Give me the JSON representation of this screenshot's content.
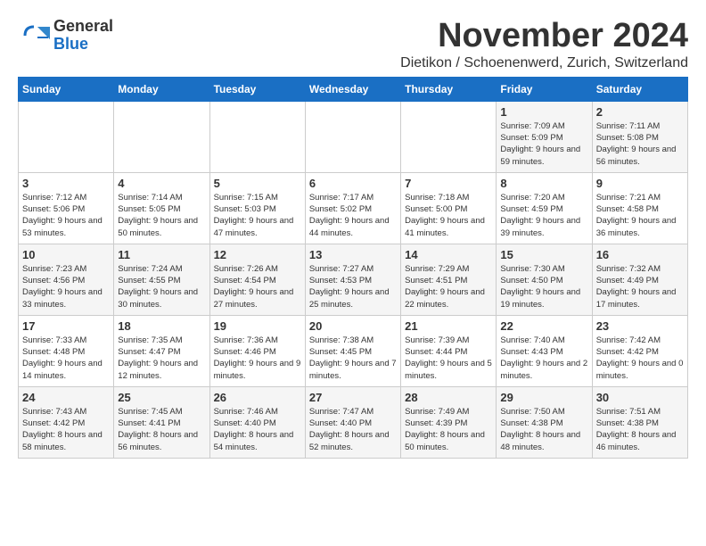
{
  "logo": {
    "general": "General",
    "blue": "Blue"
  },
  "title": "November 2024",
  "location": "Dietikon / Schoenenwerd, Zurich, Switzerland",
  "days_of_week": [
    "Sunday",
    "Monday",
    "Tuesday",
    "Wednesday",
    "Thursday",
    "Friday",
    "Saturday"
  ],
  "weeks": [
    [
      {
        "day": "",
        "info": ""
      },
      {
        "day": "",
        "info": ""
      },
      {
        "day": "",
        "info": ""
      },
      {
        "day": "",
        "info": ""
      },
      {
        "day": "",
        "info": ""
      },
      {
        "day": "1",
        "info": "Sunrise: 7:09 AM\nSunset: 5:09 PM\nDaylight: 9 hours and 59 minutes."
      },
      {
        "day": "2",
        "info": "Sunrise: 7:11 AM\nSunset: 5:08 PM\nDaylight: 9 hours and 56 minutes."
      }
    ],
    [
      {
        "day": "3",
        "info": "Sunrise: 7:12 AM\nSunset: 5:06 PM\nDaylight: 9 hours and 53 minutes."
      },
      {
        "day": "4",
        "info": "Sunrise: 7:14 AM\nSunset: 5:05 PM\nDaylight: 9 hours and 50 minutes."
      },
      {
        "day": "5",
        "info": "Sunrise: 7:15 AM\nSunset: 5:03 PM\nDaylight: 9 hours and 47 minutes."
      },
      {
        "day": "6",
        "info": "Sunrise: 7:17 AM\nSunset: 5:02 PM\nDaylight: 9 hours and 44 minutes."
      },
      {
        "day": "7",
        "info": "Sunrise: 7:18 AM\nSunset: 5:00 PM\nDaylight: 9 hours and 41 minutes."
      },
      {
        "day": "8",
        "info": "Sunrise: 7:20 AM\nSunset: 4:59 PM\nDaylight: 9 hours and 39 minutes."
      },
      {
        "day": "9",
        "info": "Sunrise: 7:21 AM\nSunset: 4:58 PM\nDaylight: 9 hours and 36 minutes."
      }
    ],
    [
      {
        "day": "10",
        "info": "Sunrise: 7:23 AM\nSunset: 4:56 PM\nDaylight: 9 hours and 33 minutes."
      },
      {
        "day": "11",
        "info": "Sunrise: 7:24 AM\nSunset: 4:55 PM\nDaylight: 9 hours and 30 minutes."
      },
      {
        "day": "12",
        "info": "Sunrise: 7:26 AM\nSunset: 4:54 PM\nDaylight: 9 hours and 27 minutes."
      },
      {
        "day": "13",
        "info": "Sunrise: 7:27 AM\nSunset: 4:53 PM\nDaylight: 9 hours and 25 minutes."
      },
      {
        "day": "14",
        "info": "Sunrise: 7:29 AM\nSunset: 4:51 PM\nDaylight: 9 hours and 22 minutes."
      },
      {
        "day": "15",
        "info": "Sunrise: 7:30 AM\nSunset: 4:50 PM\nDaylight: 9 hours and 19 minutes."
      },
      {
        "day": "16",
        "info": "Sunrise: 7:32 AM\nSunset: 4:49 PM\nDaylight: 9 hours and 17 minutes."
      }
    ],
    [
      {
        "day": "17",
        "info": "Sunrise: 7:33 AM\nSunset: 4:48 PM\nDaylight: 9 hours and 14 minutes."
      },
      {
        "day": "18",
        "info": "Sunrise: 7:35 AM\nSunset: 4:47 PM\nDaylight: 9 hours and 12 minutes."
      },
      {
        "day": "19",
        "info": "Sunrise: 7:36 AM\nSunset: 4:46 PM\nDaylight: 9 hours and 9 minutes."
      },
      {
        "day": "20",
        "info": "Sunrise: 7:38 AM\nSunset: 4:45 PM\nDaylight: 9 hours and 7 minutes."
      },
      {
        "day": "21",
        "info": "Sunrise: 7:39 AM\nSunset: 4:44 PM\nDaylight: 9 hours and 5 minutes."
      },
      {
        "day": "22",
        "info": "Sunrise: 7:40 AM\nSunset: 4:43 PM\nDaylight: 9 hours and 2 minutes."
      },
      {
        "day": "23",
        "info": "Sunrise: 7:42 AM\nSunset: 4:42 PM\nDaylight: 9 hours and 0 minutes."
      }
    ],
    [
      {
        "day": "24",
        "info": "Sunrise: 7:43 AM\nSunset: 4:42 PM\nDaylight: 8 hours and 58 minutes."
      },
      {
        "day": "25",
        "info": "Sunrise: 7:45 AM\nSunset: 4:41 PM\nDaylight: 8 hours and 56 minutes."
      },
      {
        "day": "26",
        "info": "Sunrise: 7:46 AM\nSunset: 4:40 PM\nDaylight: 8 hours and 54 minutes."
      },
      {
        "day": "27",
        "info": "Sunrise: 7:47 AM\nSunset: 4:40 PM\nDaylight: 8 hours and 52 minutes."
      },
      {
        "day": "28",
        "info": "Sunrise: 7:49 AM\nSunset: 4:39 PM\nDaylight: 8 hours and 50 minutes."
      },
      {
        "day": "29",
        "info": "Sunrise: 7:50 AM\nSunset: 4:38 PM\nDaylight: 8 hours and 48 minutes."
      },
      {
        "day": "30",
        "info": "Sunrise: 7:51 AM\nSunset: 4:38 PM\nDaylight: 8 hours and 46 minutes."
      }
    ]
  ]
}
